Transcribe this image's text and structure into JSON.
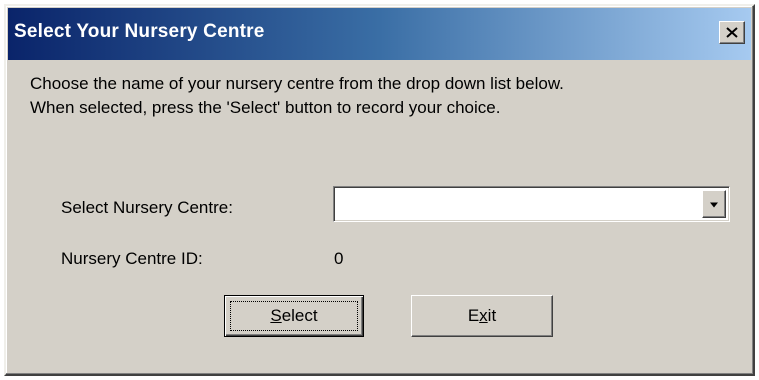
{
  "window": {
    "title": "Select Your Nursery Centre",
    "close_label": "×"
  },
  "instructions": {
    "line1": "Choose the name of your nursery centre from the drop down list below.",
    "line2": "When selected, press the 'Select' button to record your choice."
  },
  "form": {
    "centre_label": "Select Nursery Centre:",
    "centre_value": "",
    "id_label": "Nursery Centre ID:",
    "id_value": "0"
  },
  "buttons": {
    "select": {
      "pre": "",
      "mnemonic": "S",
      "post": "elect"
    },
    "exit": {
      "pre": "E",
      "mnemonic": "x",
      "post": "it"
    }
  },
  "icons": {
    "close": "close-icon",
    "dropdown": "chevron-down-icon"
  },
  "colors": {
    "title_gradient_start": "#0a246a",
    "title_gradient_end": "#a6caf0",
    "dialog_face": "#d4d0c8"
  }
}
